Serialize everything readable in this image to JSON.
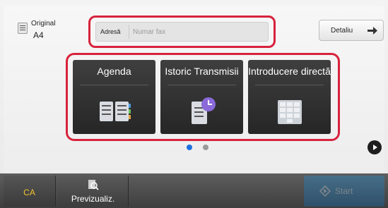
{
  "original": {
    "label": "Original",
    "size": "A4"
  },
  "address": {
    "label": "Adresă",
    "placeholder": "Numar fax"
  },
  "detail_button": {
    "label": "Detaliu"
  },
  "tiles": [
    {
      "label": "Agenda",
      "icon": "address-book-icon"
    },
    {
      "label": "Istoric Transmisii",
      "icon": "history-icon"
    },
    {
      "label": "Introducere directă",
      "icon": "keypad-icon"
    }
  ],
  "pagination": {
    "page_count": 2,
    "current_page": 1
  },
  "bottom_bar": {
    "ca_label": "CA",
    "preview_label": "Previzualiz.",
    "start_label": "Start"
  },
  "colors": {
    "highlight": "#d8223c",
    "ca_text": "#f2c230",
    "dot_active": "#1d6fe0",
    "start": "#1f8fd7",
    "history_badge": "#8a6ad8"
  }
}
